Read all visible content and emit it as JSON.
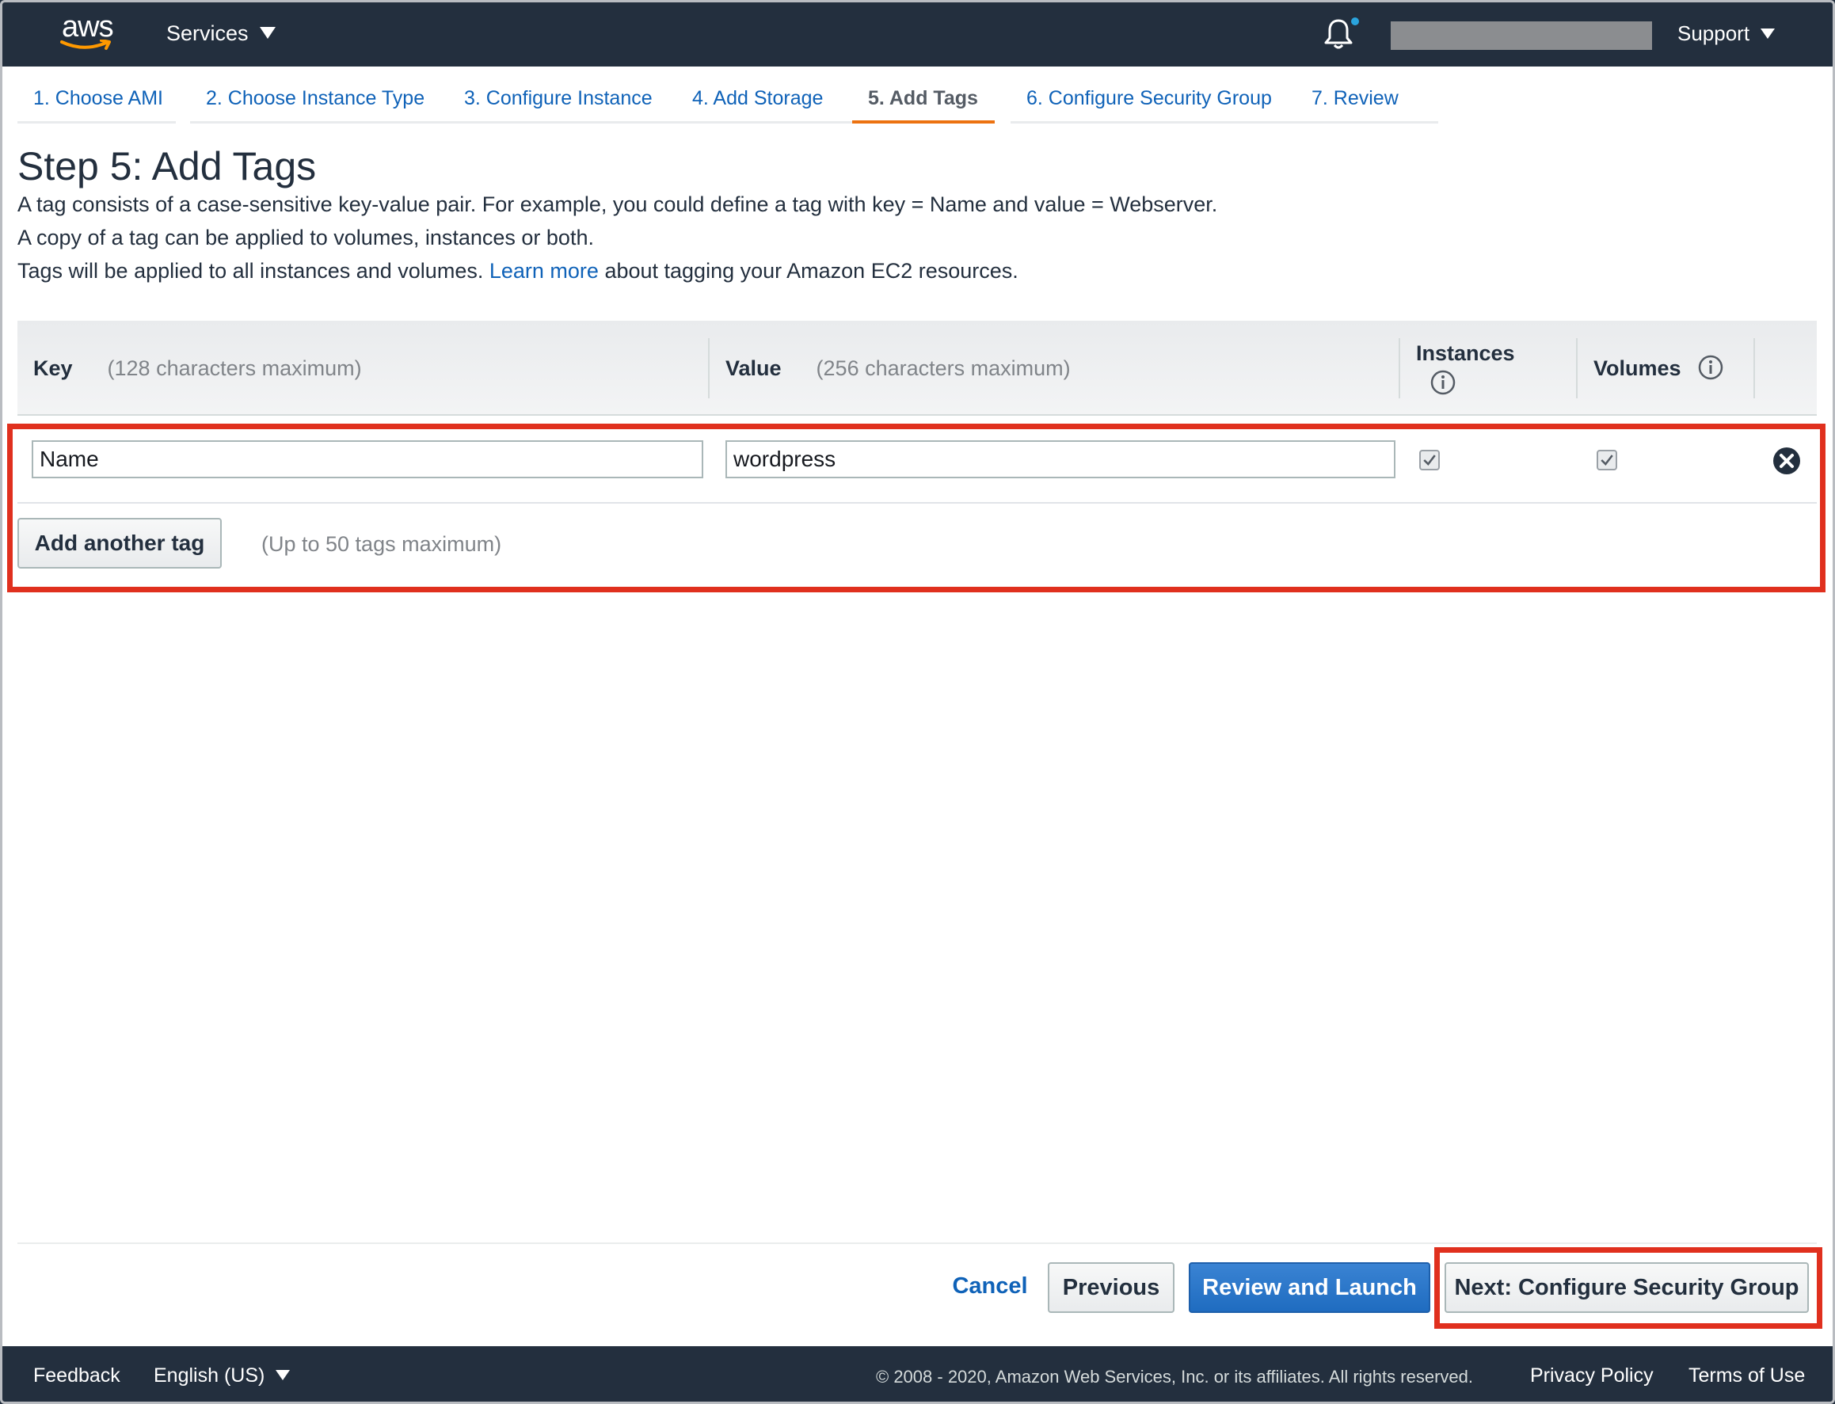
{
  "nav": {
    "logo_text": "aws",
    "services_label": "Services",
    "support_label": "Support"
  },
  "tabs": [
    {
      "label": "1. Choose AMI"
    },
    {
      "label": "2. Choose Instance Type"
    },
    {
      "label": "3. Configure Instance"
    },
    {
      "label": "4. Add Storage"
    },
    {
      "label": "5. Add Tags",
      "active": true
    },
    {
      "label": "6. Configure Security Group"
    },
    {
      "label": "7. Review"
    }
  ],
  "page": {
    "title": "Step 5: Add Tags",
    "desc_line1": "A tag consists of a case-sensitive key-value pair. For example, you could define a tag with key = Name and value = Webserver.",
    "desc_line2": "A copy of a tag can be applied to volumes, instances or both.",
    "desc_line3_before": "Tags will be applied to all instances and volumes.",
    "desc_line3_link": "Learn more",
    "desc_line3_after": "about tagging your Amazon EC2 resources."
  },
  "table": {
    "key_header": "Key",
    "key_hint": "(128 characters maximum)",
    "value_header": "Value",
    "value_hint": "(256 characters maximum)",
    "instances_header": "Instances",
    "volumes_header": "Volumes",
    "rows": [
      {
        "key": "Name",
        "value": "wordpress",
        "instances_checked": true,
        "volumes_checked": true
      }
    ],
    "add_button_label": "Add another tag",
    "add_hint": "(Up to 50 tags maximum)"
  },
  "actions": {
    "cancel_label": "Cancel",
    "previous_label": "Previous",
    "review_launch_label": "Review and Launch",
    "next_label": "Next: Configure Security Group"
  },
  "footer": {
    "feedback_label": "Feedback",
    "language_label": "English (US)",
    "copyright": "© 2008 - 2020, Amazon Web Services, Inc. or its affiliates. All rights reserved.",
    "privacy_label": "Privacy Policy",
    "terms_label": "Terms of Use"
  },
  "colors": {
    "nav_bg": "#232f3e",
    "link_blue": "#0f62b8",
    "active_tab_orange": "#ec7211",
    "primary_button": "#1f6cc0",
    "highlight_red": "#e0301e"
  }
}
